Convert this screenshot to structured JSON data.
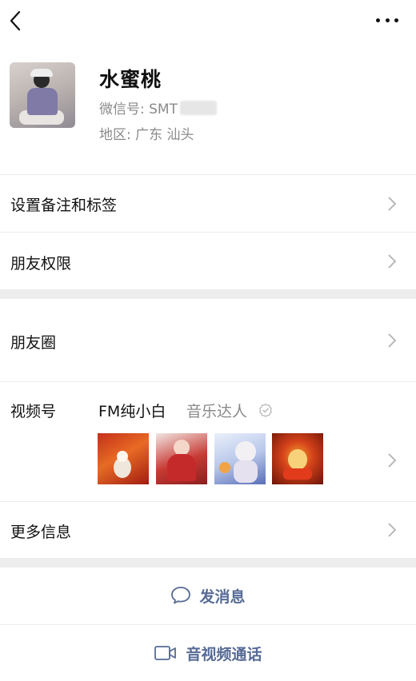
{
  "topbar": {
    "back_icon": "chevron-left-icon",
    "more_icon": "more-dots-icon"
  },
  "profile": {
    "nickname": "水蜜桃",
    "wechat_id_label": "微信号: SMT",
    "region_label": "地区: 广东  汕头"
  },
  "menu": {
    "remark_tags": "设置备注和标签",
    "friend_permissions": "朋友权限",
    "moments": "朋友圈",
    "channels": "视频号",
    "more_info": "更多信息"
  },
  "channels": {
    "name": "FM纯小白",
    "tag": "音乐达人"
  },
  "actions": {
    "send_message": "发消息",
    "video_call": "音视频通话"
  },
  "colors": {
    "link_blue": "#576b95",
    "secondary_text": "#8a8a8a",
    "section_gap": "#ededed"
  }
}
